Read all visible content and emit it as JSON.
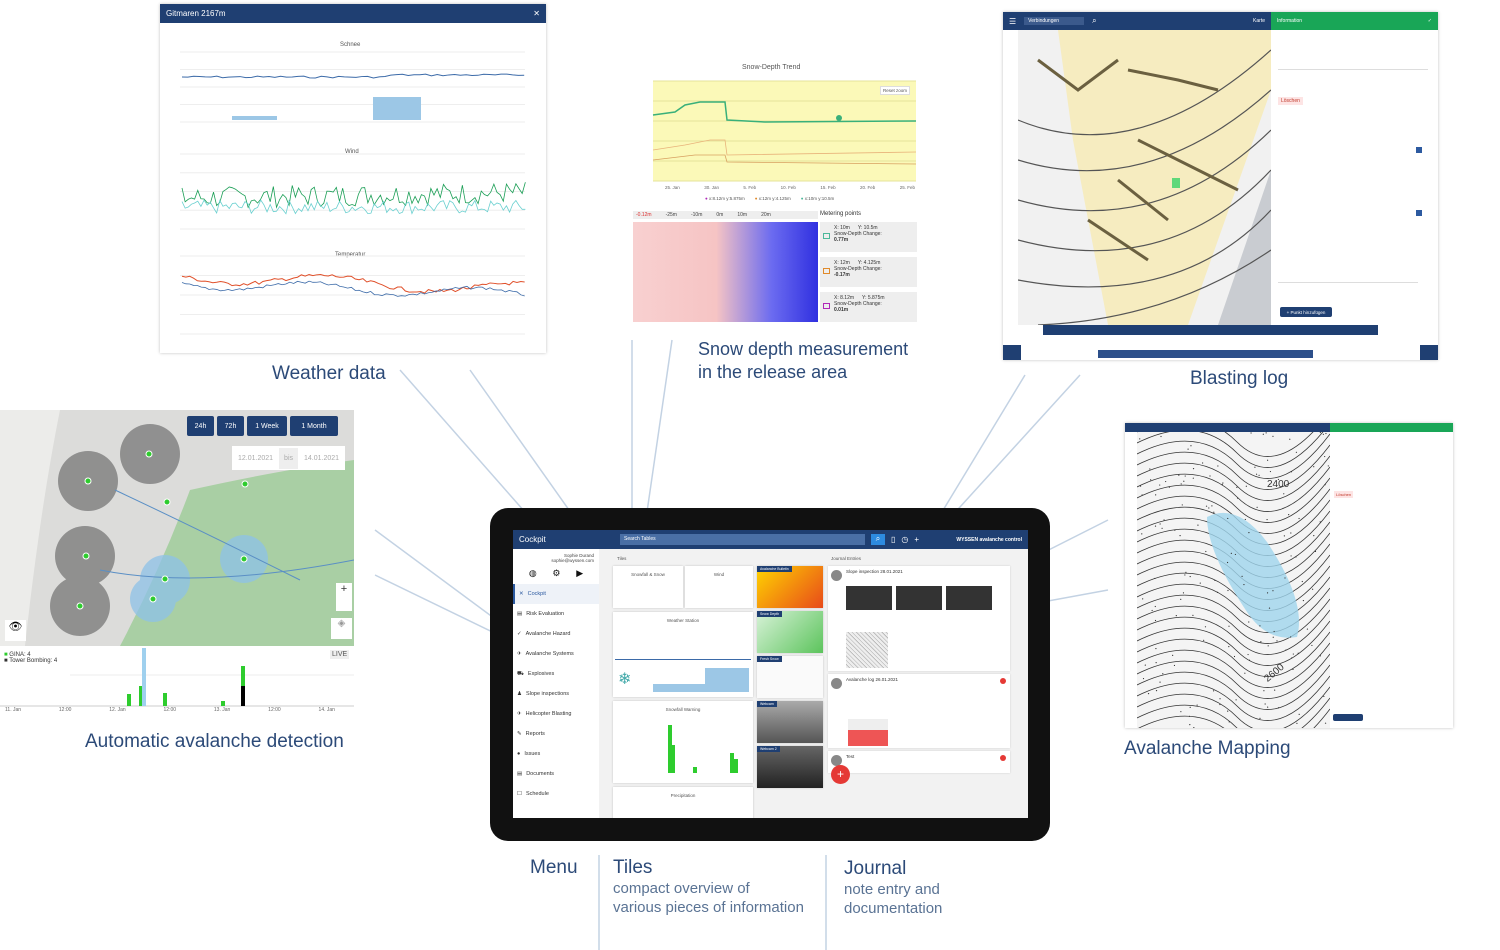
{
  "captions": {
    "weather": "Weather data",
    "snow_depth_line1": "Snow depth measurement",
    "snow_depth_line2": "in the release area",
    "blasting": "Blasting log",
    "detection": "Automatic avalanche detection",
    "mapping": "Avalanche Mapping",
    "menu": "Menu",
    "tiles": "Tiles",
    "tiles_sub1": "compact overview of",
    "tiles_sub2": "various pieces of information",
    "journal": "Journal",
    "journal_sub1": "note entry and",
    "journal_sub2": "documentation"
  },
  "weather": {
    "title": "Gitmaren 2167m",
    "charts": [
      "Schnee",
      "Wind",
      "Temperatur"
    ]
  },
  "snow_depth": {
    "title": "Snow-Depth Trend",
    "reset": "Reset zoom",
    "x_ticks": [
      "25. Jan",
      "30. Jan",
      "5. Feb",
      "10. Feb",
      "15. Feb",
      "20. Feb",
      "25. Feb"
    ],
    "legend": [
      "x:8.12m y:5.875m",
      "x:12m y:4.125m",
      "x:10m y:10.5m"
    ],
    "scale": [
      "-0.12m",
      "-25m",
      "-10m",
      "0m",
      "10m",
      "20m"
    ],
    "metering_title": "Metering points",
    "points": [
      {
        "x": "X: 10m",
        "y": "Y: 10.5m",
        "label": "Snow-Depth Change:",
        "value": "0.77m",
        "color": "#4cb89a"
      },
      {
        "x": "X: 12m",
        "y": "Y: 4.125m",
        "label": "Snow-Depth Change:",
        "value": "-0.17m",
        "color": "#e08a2a"
      },
      {
        "x": "X: 8.12m",
        "y": "Y: 5.875m",
        "label": "Snow-Depth Change:",
        "value": "0.01m",
        "color": "#b02ab8"
      }
    ]
  },
  "blasting": {
    "search": "Verbindungen",
    "map_label": "Karte",
    "panel_title": "Information",
    "delete": "Löschen",
    "add_button": "+ Punkt hinzufügen"
  },
  "detection": {
    "ranges": [
      "24h",
      "72h",
      "1 Week",
      "1 Month"
    ],
    "date_from": "12.01.2021",
    "date_sep": "bis",
    "date_to": "14.01.2021",
    "live": "LIVE",
    "legend": [
      "GINA: 4",
      "Tower Bombing: 4"
    ],
    "x_ticks": [
      "11. Jan",
      "12:00",
      "12. Jan",
      "12:00",
      "13. Jan",
      "12:00",
      "14. Jan"
    ]
  },
  "mapping": {
    "contours": [
      "2400",
      "2600"
    ],
    "delete": "Löschen"
  },
  "cockpit": {
    "app_title": "Cockpit",
    "search_placeholder": "Search Tables",
    "user_name": "Sophie Durand",
    "user_email": "sophie@wyssen.com",
    "brand": "WYSSEN avalanche control",
    "menu": [
      "Cockpit",
      "Risk Evaluation",
      "Avalanche Hazard",
      "Avalanche Systems",
      "Explosives",
      "Slope inspections",
      "Helicopter Blasting",
      "Reports",
      "Issues",
      "Documents",
      "Schedule"
    ],
    "tiles_header": "Tiles",
    "tile_titles": [
      "Snowfall & Snow",
      "Wind",
      "Weather Station",
      "Snowfall Warning",
      "Precipitation"
    ],
    "image_tiles": [
      "Avalanche Bulletin",
      "Snow Depth",
      "Fresh Snow",
      "Webcam",
      "Webcam 2"
    ],
    "journal_header": "Journal Entries",
    "journal_entries": [
      "Slope inspection 28.01.2021",
      "Avalanche log 26.01.2021",
      "Test"
    ],
    "colors": {
      "primary": "#1f3f72",
      "accent": "#e53935",
      "green": "#2ecc2e"
    }
  }
}
